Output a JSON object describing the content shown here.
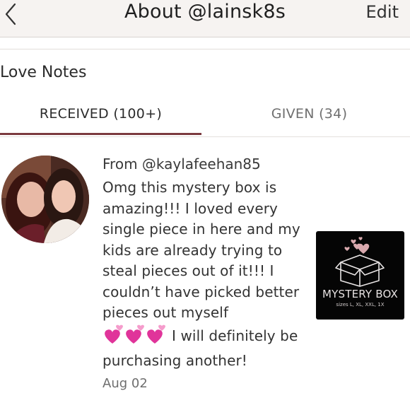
{
  "header": {
    "title": "About @lainsk8s",
    "edit_label": "Edit",
    "back_icon": "chevron-left-icon"
  },
  "section": {
    "title": "Love Notes"
  },
  "tabs": [
    {
      "label": "RECEIVED (100+)",
      "active": true
    },
    {
      "label": "GIVEN (34)",
      "active": false
    }
  ],
  "note": {
    "from": "From @kaylafeehan85",
    "text_before_hearts": "Omg this mystery box is amazing!!! I loved every single piece in here and my kids are already trying to steal pieces out of it!!! I couldn’t have picked better pieces out myself",
    "text_after_hearts": "I will definitely be purchasing another!",
    "date": "Aug 02"
  },
  "product": {
    "title": "MYSTERY BOX",
    "subtitle": "sizes L, XL, XXL, 1X"
  },
  "colors": {
    "accent": "#7b3a3f",
    "header_bg": "#f6f3f1",
    "heart_pink": "#e0349a"
  }
}
